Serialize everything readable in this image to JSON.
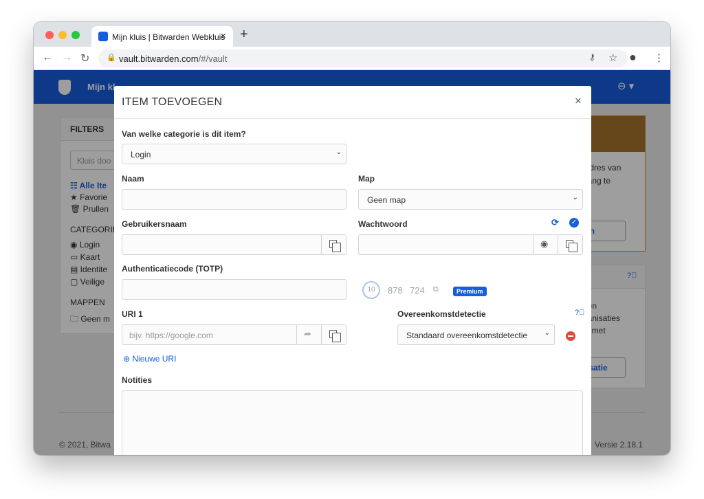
{
  "browser": {
    "tab_title": "Mijn kluis | Bitwarden Webkluis",
    "tab_close": "×",
    "new_tab": "+",
    "url_host": "vault.bitwarden.com",
    "url_path": "/#/vault"
  },
  "background": {
    "brand_text": "Mijn kl",
    "filters_title": "FILTERS",
    "search_placeholder": "Kluis doo",
    "filter_items": [
      "Alle Ite",
      "Favorie",
      "Prullen"
    ],
    "categories_title": "CATEGORIE",
    "category_items": [
      "Login",
      "Kaart",
      "Identite",
      "Veilige"
    ],
    "folders_title": "MAPPEN",
    "folder_items": [
      "Geen m"
    ],
    "card1_text": [
      "ladres van",
      "gang te"
    ],
    "card1_button": "uren",
    "card2_text": [
      "een",
      "ganisaties",
      "ig met"
    ],
    "card2_button": "anisatie",
    "footer_left": "© 2021, Bitwa",
    "footer_right": "Versie 2.18.1"
  },
  "modal": {
    "title": "ITEM TOEVOEGEN",
    "close": "×",
    "category_label": "Van welke categorie is dit item?",
    "category_value": "Login",
    "name_label": "Naam",
    "name_value": "",
    "folder_label": "Map",
    "folder_value": "Geen map",
    "username_label": "Gebruikersnaam",
    "password_label": "Wachtwoord",
    "totp_label": "Authenticatiecode (TOTP)",
    "totp_countdown": "10",
    "totp_code_1": "878",
    "totp_code_2": "724",
    "premium_badge": "Premium",
    "uri_label": "URI 1",
    "uri_placeholder": "bijv. https://google.com",
    "match_label": "Overeenkomstdetectie",
    "match_value": "Standaard overeenkomstdetectie",
    "new_uri": "Nieuwe URI",
    "notes_label": "Notities"
  }
}
